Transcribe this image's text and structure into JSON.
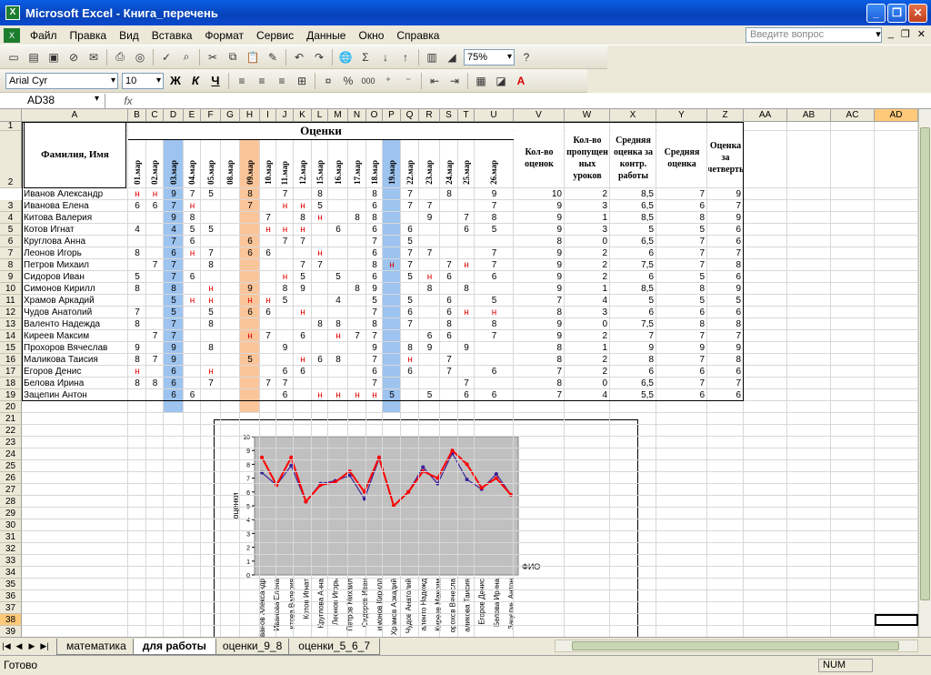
{
  "window": {
    "title": "Microsoft Excel - Книга_перечень"
  },
  "menu": [
    "Файл",
    "Правка",
    "Вид",
    "Вставка",
    "Формат",
    "Сервис",
    "Данные",
    "Окно",
    "Справка"
  ],
  "ask_placeholder": "Введите вопрос",
  "toolbar": {
    "zoom": "75%",
    "font": "Arial Cyr",
    "size": "10",
    "bold": "Ж",
    "italic": "К",
    "underline": "Ч",
    "pct": "%",
    "thousands": "000"
  },
  "namebox": "AD38",
  "fx": "fx",
  "columns": [
    "A",
    "B",
    "C",
    "D",
    "E",
    "F",
    "G",
    "H",
    "I",
    "J",
    "K",
    "L",
    "M",
    "N",
    "O",
    "P",
    "Q",
    "R",
    "S",
    "T",
    "U",
    "V",
    "W",
    "X",
    "Y",
    "Z",
    "AA",
    "AB",
    "AC",
    "AD"
  ],
  "header": {
    "name": "Фамилия, Имя",
    "grades": "Оценки",
    "count": "Кол-во оценок",
    "missed": "Кол-во пропущен ных уроков",
    "avg_control": "Средняя оценка за контр. работы",
    "avg": "Средняя оценка",
    "quarter": "Оценка за четверть"
  },
  "dates": [
    "01.мар",
    "02.мар",
    "03.мар",
    "04.мар",
    "05.мар",
    "08.мар",
    "09.мар",
    "10.мар",
    "11.мар",
    "12.мар",
    "15.мар",
    "16.мар",
    "17.мар",
    "18.мар",
    "19.мар",
    "22.мар",
    "23.мар",
    "24.мар",
    "25.мар",
    "26.мар"
  ],
  "students": [
    {
      "name": "Иванов Александр",
      "g": [
        "н",
        "н",
        "9",
        "7",
        "5",
        "",
        "8",
        "",
        "7",
        "",
        "8",
        "",
        "",
        "8",
        "",
        "7",
        "",
        "8",
        "",
        "9"
      ],
      "cnt": "10",
      "miss": "2",
      "avgc": "8,5",
      "avg": "7",
      "q": "9"
    },
    {
      "name": "Иванова Елена",
      "g": [
        "6",
        "6",
        "7",
        "н",
        "",
        "",
        "7",
        "",
        "н",
        "н",
        "5",
        "",
        "",
        "6",
        "",
        "7",
        "7",
        "",
        "",
        "7"
      ],
      "cnt": "9",
      "miss": "3",
      "avgc": "6,5",
      "avg": "6",
      "q": "7"
    },
    {
      "name": "Китова Валерия",
      "g": [
        "",
        "",
        "9",
        "8",
        "",
        "",
        "",
        "7",
        "",
        "8",
        "н",
        "",
        "8",
        "8",
        "",
        "",
        "9",
        "",
        "7",
        "8"
      ],
      "cnt": "9",
      "miss": "1",
      "avgc": "8,5",
      "avg": "8",
      "q": "9"
    },
    {
      "name": "Котов Игнат",
      "g": [
        "4",
        "",
        "4",
        "5",
        "5",
        "",
        "",
        "н",
        "н",
        "н",
        "",
        "6",
        "",
        "6",
        "",
        "6",
        "",
        "",
        "6",
        "5"
      ],
      "cnt": "9",
      "miss": "3",
      "avgc": "5",
      "avg": "5",
      "q": "6"
    },
    {
      "name": "Круглова Анна",
      "g": [
        "",
        "",
        "7",
        "6",
        "",
        "",
        "6",
        "",
        "7",
        "7",
        "",
        "",
        "",
        "7",
        "",
        "5",
        "",
        "",
        "",
        ""
      ],
      "cnt": "8",
      "miss": "0",
      "avgc": "6,5",
      "avg": "7",
      "q": "6"
    },
    {
      "name": "Леонов Игорь",
      "g": [
        "8",
        "",
        "6",
        "н",
        "7",
        "",
        "6",
        "6",
        "",
        "",
        "н",
        "",
        "",
        "6",
        "",
        "7",
        "7",
        "",
        "",
        "7"
      ],
      "cnt": "9",
      "miss": "2",
      "avgc": "6",
      "avg": "7",
      "q": "7"
    },
    {
      "name": "Петров Михаил",
      "g": [
        "",
        "7",
        "7",
        "",
        "8",
        "",
        "",
        "",
        "",
        "7",
        "7",
        "",
        "",
        "8",
        "н",
        "7",
        "",
        "7",
        "н",
        "7"
      ],
      "cnt": "9",
      "miss": "2",
      "avgc": "7,5",
      "avg": "7",
      "q": "8"
    },
    {
      "name": "Сидоров Иван",
      "g": [
        "5",
        "",
        "7",
        "6",
        "",
        "",
        "",
        "",
        "н",
        "5",
        "",
        "5",
        "",
        "6",
        "",
        "5",
        "н",
        "6",
        "",
        "6"
      ],
      "cnt": "9",
      "miss": "2",
      "avgc": "6",
      "avg": "5",
      "q": "6"
    },
    {
      "name": "Симонов Кирилл",
      "g": [
        "8",
        "",
        "8",
        "",
        "н",
        "",
        "9",
        "",
        "8",
        "9",
        "",
        "",
        "8",
        "9",
        "",
        "",
        "8",
        "",
        "8",
        ""
      ],
      "cnt": "9",
      "miss": "1",
      "avgc": "8,5",
      "avg": "8",
      "q": "9"
    },
    {
      "name": "Храмов Аркадий",
      "g": [
        "",
        "",
        "5",
        "н",
        "н",
        "",
        "н",
        "н",
        "5",
        "",
        "",
        "4",
        "",
        "5",
        "",
        "5",
        "",
        "6",
        "",
        "5"
      ],
      "cnt": "7",
      "miss": "4",
      "avgc": "5",
      "avg": "5",
      "q": "5"
    },
    {
      "name": "Чудов Анатолий",
      "g": [
        "7",
        "",
        "5",
        "",
        "5",
        "",
        "6",
        "6",
        "",
        "н",
        "",
        "",
        "",
        "7",
        "",
        "6",
        "",
        "6",
        "н",
        "н"
      ],
      "cnt": "8",
      "miss": "3",
      "avgc": "6",
      "avg": "6",
      "q": "6"
    },
    {
      "name": "Валенто Надежда",
      "g": [
        "8",
        "",
        "7",
        "",
        "8",
        "",
        "",
        "",
        "",
        "",
        "8",
        "8",
        "",
        "8",
        "",
        "7",
        "",
        "8",
        "",
        "8"
      ],
      "cnt": "9",
      "miss": "0",
      "avgc": "7,5",
      "avg": "8",
      "q": "8"
    },
    {
      "name": "Киреев Максим",
      "g": [
        "",
        "7",
        "7",
        "",
        "",
        "",
        "н",
        "7",
        "",
        "6",
        "",
        "н",
        "7",
        "7",
        "",
        "",
        "6",
        "6",
        "",
        "7"
      ],
      "cnt": "9",
      "miss": "2",
      "avgc": "7",
      "avg": "7",
      "q": "7"
    },
    {
      "name": "Прохоров Вячеслав",
      "g": [
        "9",
        "",
        "9",
        "",
        "8",
        "",
        "",
        "",
        "9",
        "",
        "",
        "",
        "",
        "9",
        "",
        "8",
        "9",
        "",
        "9",
        ""
      ],
      "cnt": "8",
      "miss": "1",
      "avgc": "9",
      "avg": "9",
      "q": "9"
    },
    {
      "name": "Маликова Таисия",
      "g": [
        "8",
        "7",
        "9",
        "",
        "",
        "",
        "5",
        "",
        "",
        "н",
        "6",
        "8",
        "",
        "7",
        "",
        "н",
        "",
        "7",
        "",
        ""
      ],
      "cnt": "8",
      "miss": "2",
      "avgc": "8",
      "avg": "7",
      "q": "8"
    },
    {
      "name": "Егоров Денис",
      "g": [
        "н",
        "",
        "6",
        "",
        "н",
        "",
        "",
        "",
        "6",
        "6",
        "",
        "",
        "",
        "6",
        "",
        "6",
        "",
        "7",
        "",
        "6"
      ],
      "cnt": "7",
      "miss": "2",
      "avgc": "6",
      "avg": "6",
      "q": "6"
    },
    {
      "name": "Белова Ирина",
      "g": [
        "8",
        "8",
        "6",
        "",
        "7",
        "",
        "",
        "7",
        "7",
        "",
        "",
        "",
        "",
        "7",
        "",
        "",
        "",
        "",
        "7",
        ""
      ],
      "cnt": "8",
      "miss": "0",
      "avgc": "6,5",
      "avg": "7",
      "q": "7"
    },
    {
      "name": "Зацепин Антон",
      "g": [
        "",
        "",
        "6",
        "6",
        "",
        "",
        "",
        "",
        "6",
        "",
        "н",
        "н",
        "н",
        "н",
        "5",
        "",
        "5",
        "",
        "6",
        "6"
      ],
      "cnt": "7",
      "miss": "4",
      "avgc": "5,5",
      "avg": "6",
      "q": "6"
    }
  ],
  "chart_data": {
    "type": "line",
    "ylabel": "оценки",
    "xlabel": "ФИО",
    "ylim": [
      0,
      10
    ],
    "yticks": [
      "0",
      "1",
      "2",
      "3",
      "4",
      "5",
      "6",
      "7",
      "8",
      "9",
      "10"
    ],
    "categories": [
      "Иванов Александр",
      "Иванова Елена",
      "Китова Валерия",
      "Котов Игнат",
      "Круглова Анна",
      "Леонов Игорь",
      "Петров Михаил",
      "Сидоров Иван",
      "Симонов Кирилл",
      "Храмов Аркадий",
      "Чудов Анатолий",
      "Валенто Надежда",
      "Киреев Максим",
      "Прохоров Вячеслав",
      "Маликова Таисия",
      "Егоров Денис",
      "Белова Ирина",
      "Зацепин Антон"
    ],
    "category_labels": [
      "ванов Александр",
      "Иванова Елена",
      "итова Валерия",
      "Котов Игнат",
      "Круглова Анна",
      "Леонов Игорь",
      "Петров Михаил",
      "Сидоров Иван",
      "имонов Кирилл",
      "Храмов Аркадий",
      "Чудов Анатолий",
      "аленто Надежд",
      "Киреев Максим",
      "орохов Вячесла",
      "аликова Таисия",
      "Егоров Денис",
      "Белова Ирина",
      "Зацепин Антон"
    ],
    "series": [
      {
        "values": [
          7.4,
          6.5,
          7.9,
          5.3,
          6.6,
          6.8,
          7.2,
          5.5,
          8.4,
          5.0,
          6.0,
          7.8,
          6.6,
          8.8,
          6.9,
          6.2,
          7.3,
          5.8
        ],
        "color": "#3b1f9a"
      },
      {
        "values": [
          8.5,
          6.5,
          8.5,
          5.3,
          6.5,
          6.7,
          7.5,
          6.0,
          8.5,
          5.0,
          6.0,
          7.5,
          7.0,
          9.0,
          8.0,
          6.3,
          7.0,
          5.8
        ],
        "color": "#ff0000"
      }
    ]
  },
  "sheets": [
    "математика",
    "для работы",
    "оценки_9_8",
    "оценки_5_6_7"
  ],
  "status": {
    "ready": "Готово",
    "num": "NUM"
  }
}
